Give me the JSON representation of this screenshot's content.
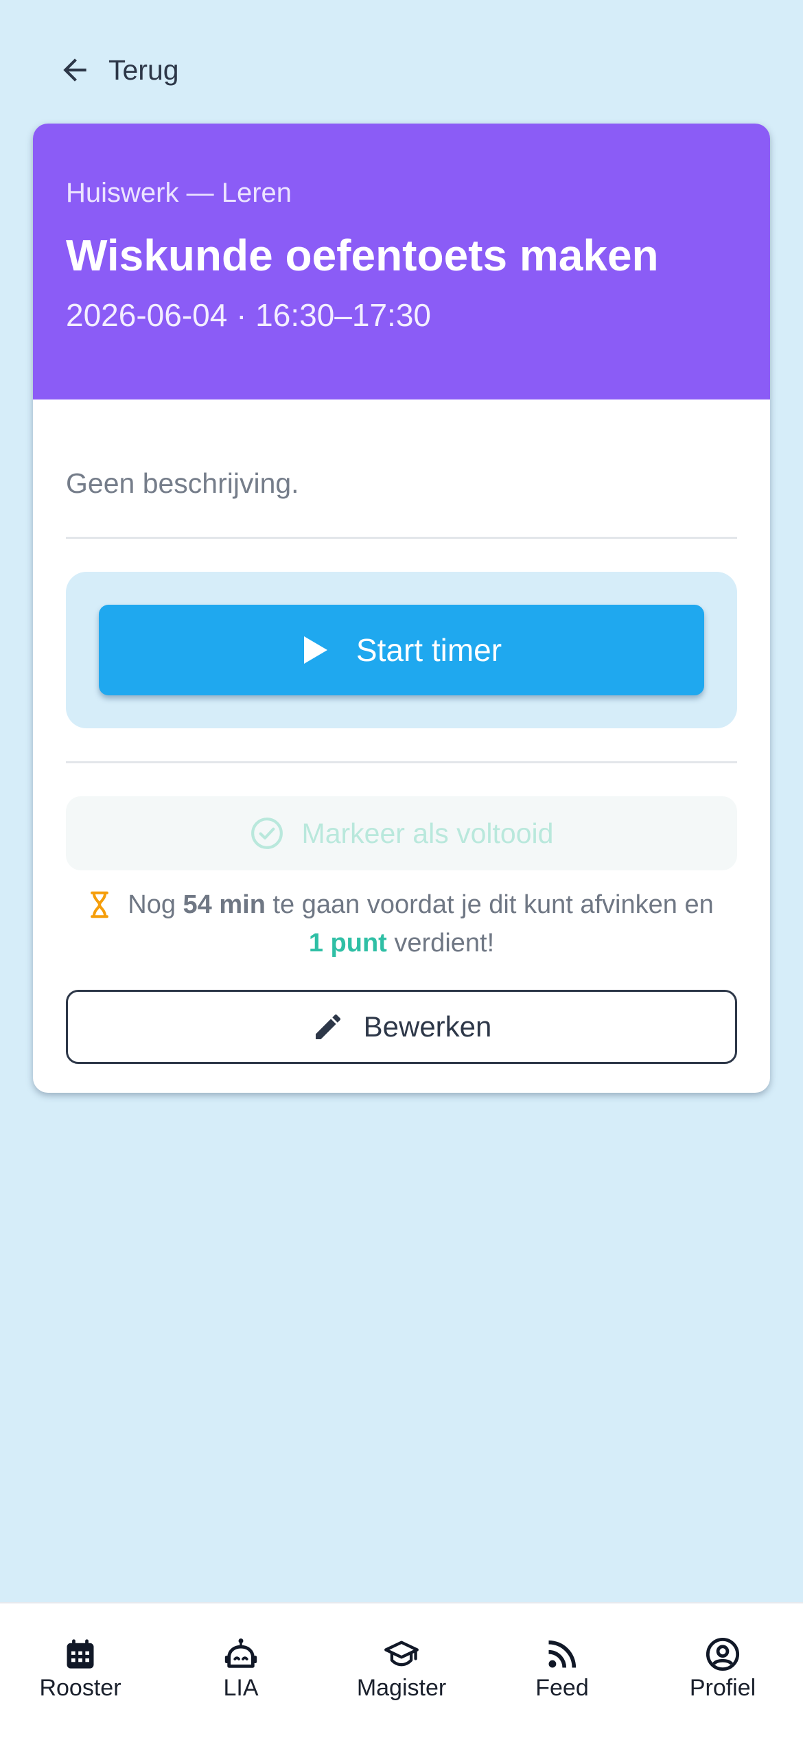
{
  "back": {
    "label": "Terug"
  },
  "task": {
    "kicker": "Huiswerk — Leren",
    "title": "Wiskunde oefentoets maken",
    "datetime": "2026-06-04 · 16:30–17:30",
    "header_color": "#8b5cf6",
    "description": "Geen beschrijving."
  },
  "timer": {
    "start_label": "Start timer",
    "button_color": "#1fa8ef"
  },
  "complete": {
    "label": "Markeer als voltooid"
  },
  "hint": {
    "prefix": "Nog",
    "remaining": "54 min",
    "middle": "te gaan voordat je dit kunt afvinken en",
    "points": "1 punt",
    "suffix": "verdient!"
  },
  "edit": {
    "label": "Bewerken"
  },
  "nav": {
    "items": [
      {
        "label": "Rooster",
        "icon": "calendar-icon"
      },
      {
        "label": "LIA",
        "icon": "robot-icon"
      },
      {
        "label": "Magister",
        "icon": "graduation-cap-icon"
      },
      {
        "label": "Feed",
        "icon": "rss-icon"
      },
      {
        "label": "Profiel",
        "icon": "user-circle-icon"
      }
    ]
  }
}
